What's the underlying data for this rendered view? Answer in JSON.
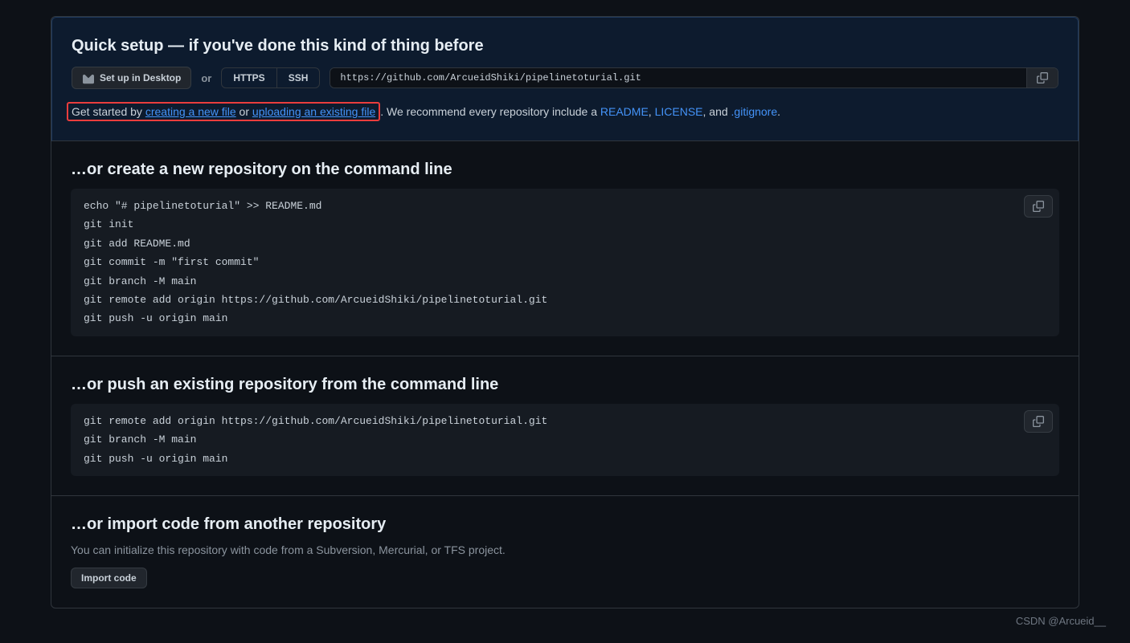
{
  "quick_setup": {
    "title": "Quick setup — if you've done this kind of thing before",
    "desktop_btn": "Set up in Desktop",
    "or": "or",
    "https": "HTTPS",
    "ssh": "SSH",
    "clone_url": "https://github.com/ArcueidShiki/pipelinetoturial.git",
    "get_started_prefix": "Get started by ",
    "create_file_link": "creating a new file",
    "or_word": " or ",
    "upload_link": "uploading an existing file",
    "get_started_suffix": ". We recommend every repository include a ",
    "readme_link": "README",
    "comma1": ", ",
    "license_link": "LICENSE",
    "and_word": ", and ",
    "gitignore_link": ".gitignore",
    "period": "."
  },
  "section_create": {
    "title": "…or create a new repository on the command line",
    "code": "echo \"# pipelinetoturial\" >> README.md\ngit init\ngit add README.md\ngit commit -m \"first commit\"\ngit branch -M main\ngit remote add origin https://github.com/ArcueidShiki/pipelinetoturial.git\ngit push -u origin main"
  },
  "section_push": {
    "title": "…or push an existing repository from the command line",
    "code": "git remote add origin https://github.com/ArcueidShiki/pipelinetoturial.git\ngit branch -M main\ngit push -u origin main"
  },
  "section_import": {
    "title": "…or import code from another repository",
    "desc": "You can initialize this repository with code from a Subversion, Mercurial, or TFS project.",
    "btn": "Import code"
  },
  "watermark": "CSDN @Arcueid__"
}
